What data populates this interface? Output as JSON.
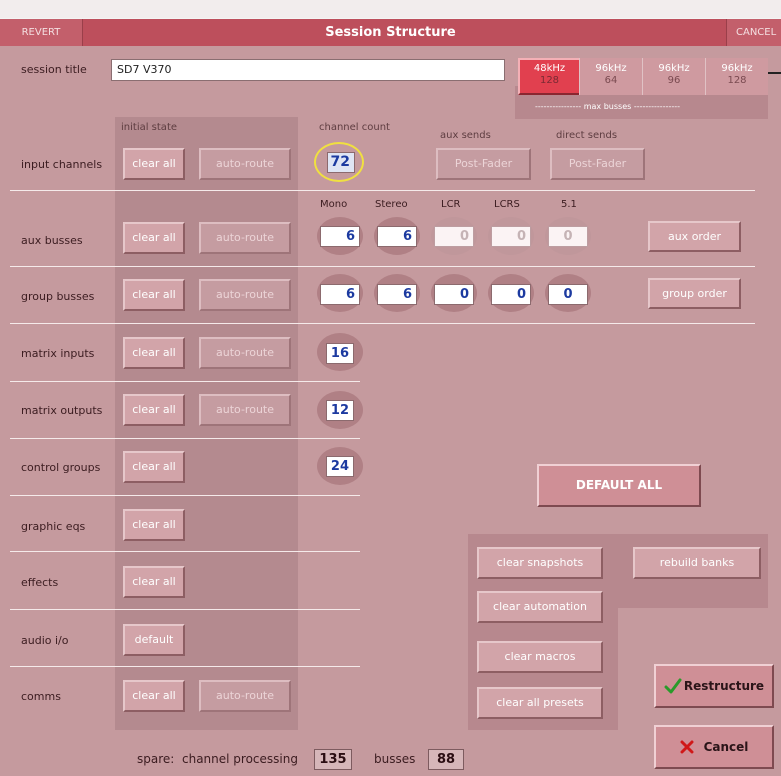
{
  "window": {
    "title": "Session Structure",
    "revert_label": "REVERT",
    "cancel_label": "CANCEL"
  },
  "session": {
    "label": "session title",
    "value": "SD7 V370"
  },
  "sample_rates": {
    "options": [
      {
        "rate": "48kHz",
        "busses": "128",
        "selected": true
      },
      {
        "rate": "96kHz",
        "busses": "64",
        "selected": false
      },
      {
        "rate": "96kHz",
        "busses": "96",
        "selected": false
      },
      {
        "rate": "96kHz",
        "busses": "128",
        "selected": false
      }
    ],
    "caption": "---------------- max busses ----------------"
  },
  "headers": {
    "initial_state": "initial state",
    "channel_count": "channel count",
    "aux_sends": "aux sends",
    "direct_sends": "direct sends"
  },
  "bus_types": [
    "Mono",
    "Stereo",
    "LCR",
    "LCRS",
    "5.1"
  ],
  "rows": {
    "input_channels": {
      "label": "input channels",
      "clear": "clear all",
      "route": "auto-route",
      "count": "72",
      "aux_sends": "Post-Fader",
      "direct_sends": "Post-Fader"
    },
    "aux_busses": {
      "label": "aux busses",
      "clear": "clear all",
      "route": "auto-route",
      "values": [
        "6",
        "6",
        "0",
        "0",
        "0"
      ],
      "order": "aux order"
    },
    "group_busses": {
      "label": "group busses",
      "clear": "clear all",
      "route": "auto-route",
      "values": [
        "6",
        "6",
        "0",
        "0",
        "0"
      ],
      "order": "group order"
    },
    "matrix_inputs": {
      "label": "matrix inputs",
      "clear": "clear all",
      "route": "auto-route",
      "count": "16"
    },
    "matrix_outputs": {
      "label": "matrix outputs",
      "clear": "clear all",
      "route": "auto-route",
      "count": "12"
    },
    "control_groups": {
      "label": "control groups",
      "clear": "clear all",
      "count": "24"
    },
    "graphic_eqs": {
      "label": "graphic eqs",
      "clear": "clear all"
    },
    "effects": {
      "label": "effects",
      "clear": "clear all"
    },
    "audio_io": {
      "label": "audio i/o",
      "clear": "default"
    },
    "comms": {
      "label": "comms",
      "clear": "clear all",
      "route": "auto-route"
    }
  },
  "actions": {
    "default_all": "DEFAULT ALL",
    "clear_snapshots": "clear snapshots",
    "rebuild_banks": "rebuild banks",
    "clear_automation": "clear automation",
    "clear_macros": "clear macros",
    "clear_all_presets": "clear all presets",
    "restructure": "Restructure",
    "cancel": "Cancel"
  },
  "spare": {
    "label": "spare:",
    "channel_label": "channel processing",
    "channel_value": "135",
    "busses_label": "busses",
    "busses_value": "88"
  },
  "colors": {
    "title_bar": "#bd4f5c",
    "panel": "#c59a9e",
    "selected_rate": "#e1404f",
    "value_text": "#1c3aa0",
    "highlight_ring": "#f0e040",
    "check_green": "#2a9a2a",
    "cancel_red": "#d01818"
  }
}
